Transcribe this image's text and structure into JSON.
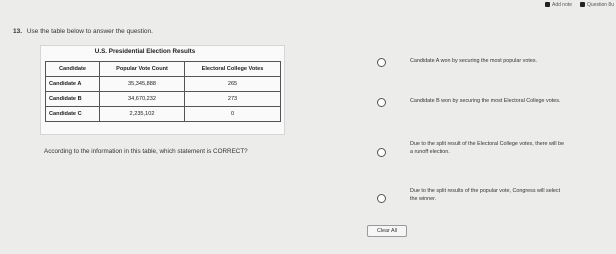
{
  "topbar": {
    "add_note": "Add note",
    "question_label": "Question 8u"
  },
  "question": {
    "number": "13.",
    "instruction": "Use the table below to answer the question.",
    "stem": "According to the information in this table, which statement is CORRECT?"
  },
  "table": {
    "title": "U.S. Presidential Election Results",
    "headers": [
      "Candidate",
      "Popular Vote Count",
      "Electoral College Votes"
    ],
    "rows": [
      [
        "Candidate A",
        "35,345,888",
        "265"
      ],
      [
        "Candidate B",
        "34,670,232",
        "273"
      ],
      [
        "Candidate C",
        "2,235,102",
        "0"
      ]
    ]
  },
  "choices": [
    {
      "lines": [
        "Candidate A won by securing the most popular votes."
      ]
    },
    {
      "lines": [
        "Candidate B won by securing the most Electoral College votes."
      ]
    },
    {
      "lines": [
        "Due to the split result of the Electoral College votes, there will be",
        "a runoff election."
      ]
    },
    {
      "lines": [
        "Due to the split results of the popular vote, Congress will select",
        "the winner."
      ]
    }
  ],
  "clear_button": "Clear All"
}
